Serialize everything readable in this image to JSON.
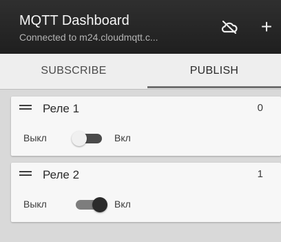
{
  "header": {
    "title": "MQTT Dashboard",
    "subtitle": "Connected to m24.cloudmqtt.c...",
    "add_symbol": "+"
  },
  "tabs": [
    {
      "label": "SUBSCRIBE",
      "selected": false
    },
    {
      "label": "PUBLISH",
      "selected": true
    }
  ],
  "items": [
    {
      "name": "Реле 1",
      "value": "0",
      "label_off": "Выкл",
      "label_on": "Вкл",
      "state": "off"
    },
    {
      "name": "Реле 2",
      "value": "1",
      "label_off": "Выкл",
      "label_on": "Вкл",
      "state": "on"
    }
  ],
  "icons": {
    "cloud_off": "cloud-off-icon",
    "add": "add-icon",
    "drag": "drag-handle-icon"
  }
}
